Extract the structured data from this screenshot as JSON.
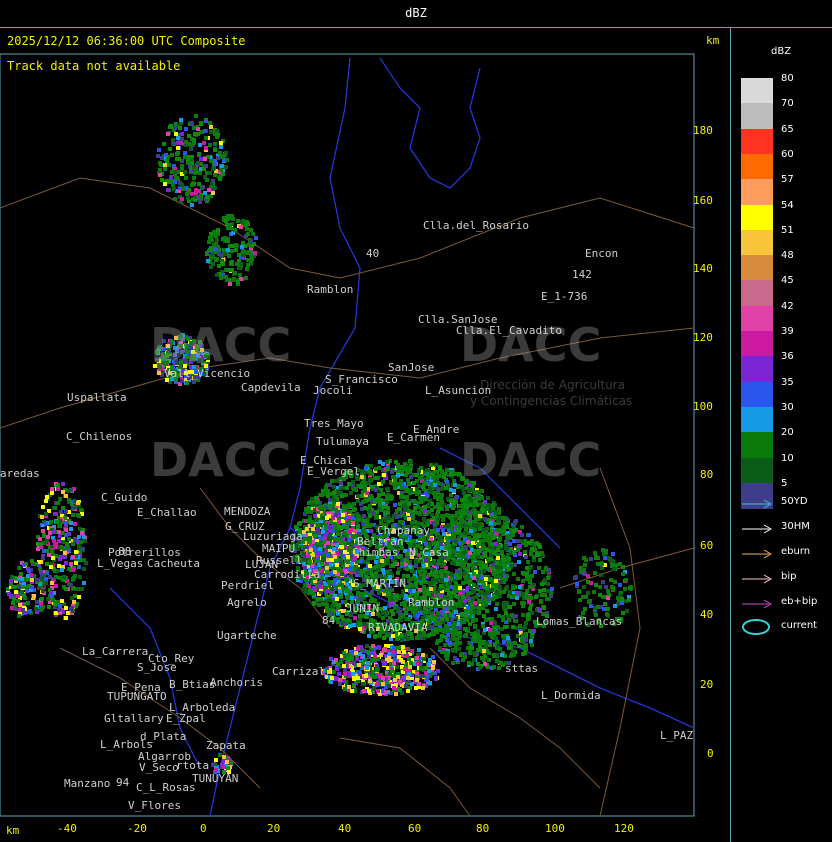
{
  "header": {
    "title": "dBZ"
  },
  "map": {
    "timestamp": "2025/12/12 06:36:00 UTC Composite",
    "track_msg": "Track data not available",
    "km_top": "km",
    "km_bottom": "km",
    "y_ticks": [
      "180",
      "160",
      "140",
      "120",
      "100",
      "80",
      "60",
      "40",
      "20",
      "0"
    ],
    "x_ticks": [
      "-40",
      "-20",
      "0",
      "20",
      "40",
      "60",
      "80",
      "100",
      "120"
    ],
    "watermark": {
      "brand": "DACC",
      "line1": "Dirección de Agricultura",
      "line2": "y Contingencias Climáticas"
    },
    "places": [
      {
        "id": "clla-del-rosario",
        "t": "Clla.del_Rosario"
      },
      {
        "id": "encon",
        "t": "Encon"
      },
      {
        "id": "n142",
        "t": "142"
      },
      {
        "id": "e1736",
        "t": "E_1-736"
      },
      {
        "id": "n40",
        "t": "40"
      },
      {
        "id": "ramblon",
        "t": "Ramblon"
      },
      {
        "id": "clla-sanjose",
        "t": "Clla.SanJose"
      },
      {
        "id": "clla-el-cavadito",
        "t": "Clla.El_Cavadito"
      },
      {
        "id": "uspallata",
        "t": "Uspallata"
      },
      {
        "id": "capdevila",
        "t": "Capdevila"
      },
      {
        "id": "s-francisco",
        "t": "S_Francisco"
      },
      {
        "id": "sanjose",
        "t": "SanJose"
      },
      {
        "id": "l-asuncion",
        "t": "L_Asuncion"
      },
      {
        "id": "jocoli",
        "t": "Jocoli"
      },
      {
        "id": "c-chilenos",
        "t": "C_Chilenos"
      },
      {
        "id": "tres-mayo",
        "t": "Tres_Mayo"
      },
      {
        "id": "tulumaya",
        "t": "Tulumaya"
      },
      {
        "id": "e-carmen",
        "t": "E_Carmen"
      },
      {
        "id": "e-andre",
        "t": "E_Andre"
      },
      {
        "id": "paredas",
        "t": "aredas"
      },
      {
        "id": "e-chical",
        "t": "E_Chical"
      },
      {
        "id": "e-vergel",
        "t": "E_Vergel"
      },
      {
        "id": "c-guido",
        "t": "C_Guido"
      },
      {
        "id": "e-challao",
        "t": "E_Challao"
      },
      {
        "id": "mendoza",
        "t": "MENDOZA"
      },
      {
        "id": "g-cruz",
        "t": "G_CRUZ"
      },
      {
        "id": "luzuriaga",
        "t": "Luzuriaga"
      },
      {
        "id": "maipu",
        "t": "MAIPU"
      },
      {
        "id": "russell",
        "t": "Russell"
      },
      {
        "id": "beltran",
        "t": "Beltran"
      },
      {
        "id": "chapanay",
        "t": "Chapanay"
      },
      {
        "id": "chimbas",
        "t": "Chimbas"
      },
      {
        "id": "n-casa",
        "t": "N_Casa"
      },
      {
        "id": "potrerillos",
        "t": "Potrerillos"
      },
      {
        "id": "l-vegas",
        "t": "L_Vegas"
      },
      {
        "id": "cacheuta",
        "t": "Cacheuta"
      },
      {
        "id": "lujan",
        "t": "LUJAN"
      },
      {
        "id": "carrodilla",
        "t": "Carrodilla"
      },
      {
        "id": "ugarteche",
        "t": "Ugarteche"
      },
      {
        "id": "agrelo",
        "t": "Agrelo"
      },
      {
        "id": "perdriel",
        "t": "Perdriel"
      },
      {
        "id": "s-martin",
        "t": "S_MARTIN"
      },
      {
        "id": "junin",
        "t": "JUNIN"
      },
      {
        "id": "rivadavia",
        "t": "RIVADAVIA"
      },
      {
        "id": "ramblon2",
        "t": "Ramblon"
      },
      {
        "id": "lomas-blancas",
        "t": "Lomas_Blancas"
      },
      {
        "id": "la-carrera",
        "t": "La_Carrera"
      },
      {
        "id": "cto-rey",
        "t": "Cto_Rey"
      },
      {
        "id": "s-jose",
        "t": "S_Jose"
      },
      {
        "id": "carrizal",
        "t": "Carrizal"
      },
      {
        "id": "e-pena",
        "t": "E_Pena"
      },
      {
        "id": "tupungato",
        "t": "TUPUNGATO"
      },
      {
        "id": "b-btias",
        "t": "B_Btias"
      },
      {
        "id": "anchoris",
        "t": "Anchoris"
      },
      {
        "id": "l-arboleda",
        "t": "L_Arboleda"
      },
      {
        "id": "gltallary",
        "t": "Gltallary"
      },
      {
        "id": "e-zpal",
        "t": "E_Zpal"
      },
      {
        "id": "d-plata",
        "t": "d_Plata"
      },
      {
        "id": "l-arbols",
        "t": "L_Arbols"
      },
      {
        "id": "algarrob",
        "t": "Algarrob"
      },
      {
        "id": "zapata",
        "t": "Zapata"
      },
      {
        "id": "l-dormida",
        "t": "L_Dormida"
      },
      {
        "id": "l-paz",
        "t": "L_PAZ"
      },
      {
        "id": "manzano",
        "t": "Manzano"
      },
      {
        "id": "tunuyan",
        "t": "TUNUYAN"
      },
      {
        "id": "c-l-rosas",
        "t": "C_L_Rosas"
      },
      {
        "id": "v-flores",
        "t": "V_Flores"
      },
      {
        "id": "v-seco",
        "t": "V_Seco"
      },
      {
        "id": "rtota",
        "t": "rtota"
      },
      {
        "id": "sttas",
        "t": "sttas"
      },
      {
        "id": "vall-vicencio",
        "t": "Vall_Vicencio"
      },
      {
        "id": "n88",
        "t": "88"
      },
      {
        "id": "n84",
        "t": "84"
      },
      {
        "id": "n94",
        "t": "94"
      }
    ]
  },
  "legend": {
    "title": "dBZ",
    "scale": [
      {
        "label": "80",
        "color": "#d9d9d9"
      },
      {
        "label": "70",
        "color": "#bdbdbd"
      },
      {
        "label": "65",
        "color": "#ff3420"
      },
      {
        "label": "60",
        "color": "#ff6a00"
      },
      {
        "label": "57",
        "color": "#ff9b5c"
      },
      {
        "label": "54",
        "color": "#ffff00"
      },
      {
        "label": "51",
        "color": "#f8c43a"
      },
      {
        "label": "48",
        "color": "#d88b3a"
      },
      {
        "label": "45",
        "color": "#c96a8c"
      },
      {
        "label": "42",
        "color": "#e040a8"
      },
      {
        "label": "39",
        "color": "#cc1aa0"
      },
      {
        "label": "36",
        "color": "#7a26d6"
      },
      {
        "label": "35",
        "color": "#2a56ee"
      },
      {
        "label": "30",
        "color": "#159be6"
      },
      {
        "label": "20",
        "color": "#0a7a0a"
      },
      {
        "label": "10",
        "color": "#0a5c16"
      },
      {
        "label": "5",
        "color": "#3d3d8c"
      }
    ],
    "tracks": [
      {
        "label": "50YD",
        "color": "#42c7d0"
      },
      {
        "label": "30HM",
        "color": "#ffffff"
      },
      {
        "label": "eburn",
        "color": "#f0b060"
      },
      {
        "label": "bip",
        "color": "#ffc8d0"
      },
      {
        "label": "eb+bip",
        "color": "#d04ad0"
      }
    ],
    "current_label": "current",
    "current_color": "#39d0d8"
  }
}
